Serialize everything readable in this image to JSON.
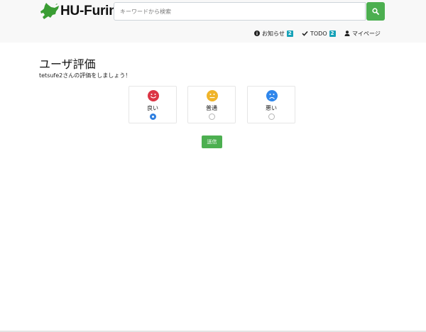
{
  "header": {
    "brand": "HU-Furima",
    "search": {
      "placeholder": "キーワードから検索",
      "value": ""
    },
    "nav": {
      "notifications": {
        "label": "お知らせ",
        "badge": "2"
      },
      "todo": {
        "label": "TODO",
        "badge": "2"
      },
      "mypage": {
        "label": "マイページ"
      }
    }
  },
  "main": {
    "title": "ユーザ評価",
    "subtitle": "tetsufe2さんの評価をしましょう！",
    "options": [
      {
        "label": "良い",
        "face": "happy",
        "color": "#dc3545",
        "selected": true
      },
      {
        "label": "普通",
        "face": "neutral",
        "color": "#f0b429",
        "selected": false
      },
      {
        "label": "悪い",
        "face": "sad",
        "color": "#2f86eb",
        "selected": false
      }
    ],
    "submit_label": "送信"
  },
  "colors": {
    "accent_green": "#4caf50",
    "badge_teal": "#17a2b8",
    "header_bg": "#f8f8f8",
    "radio_blue": "#2f7fe0"
  }
}
